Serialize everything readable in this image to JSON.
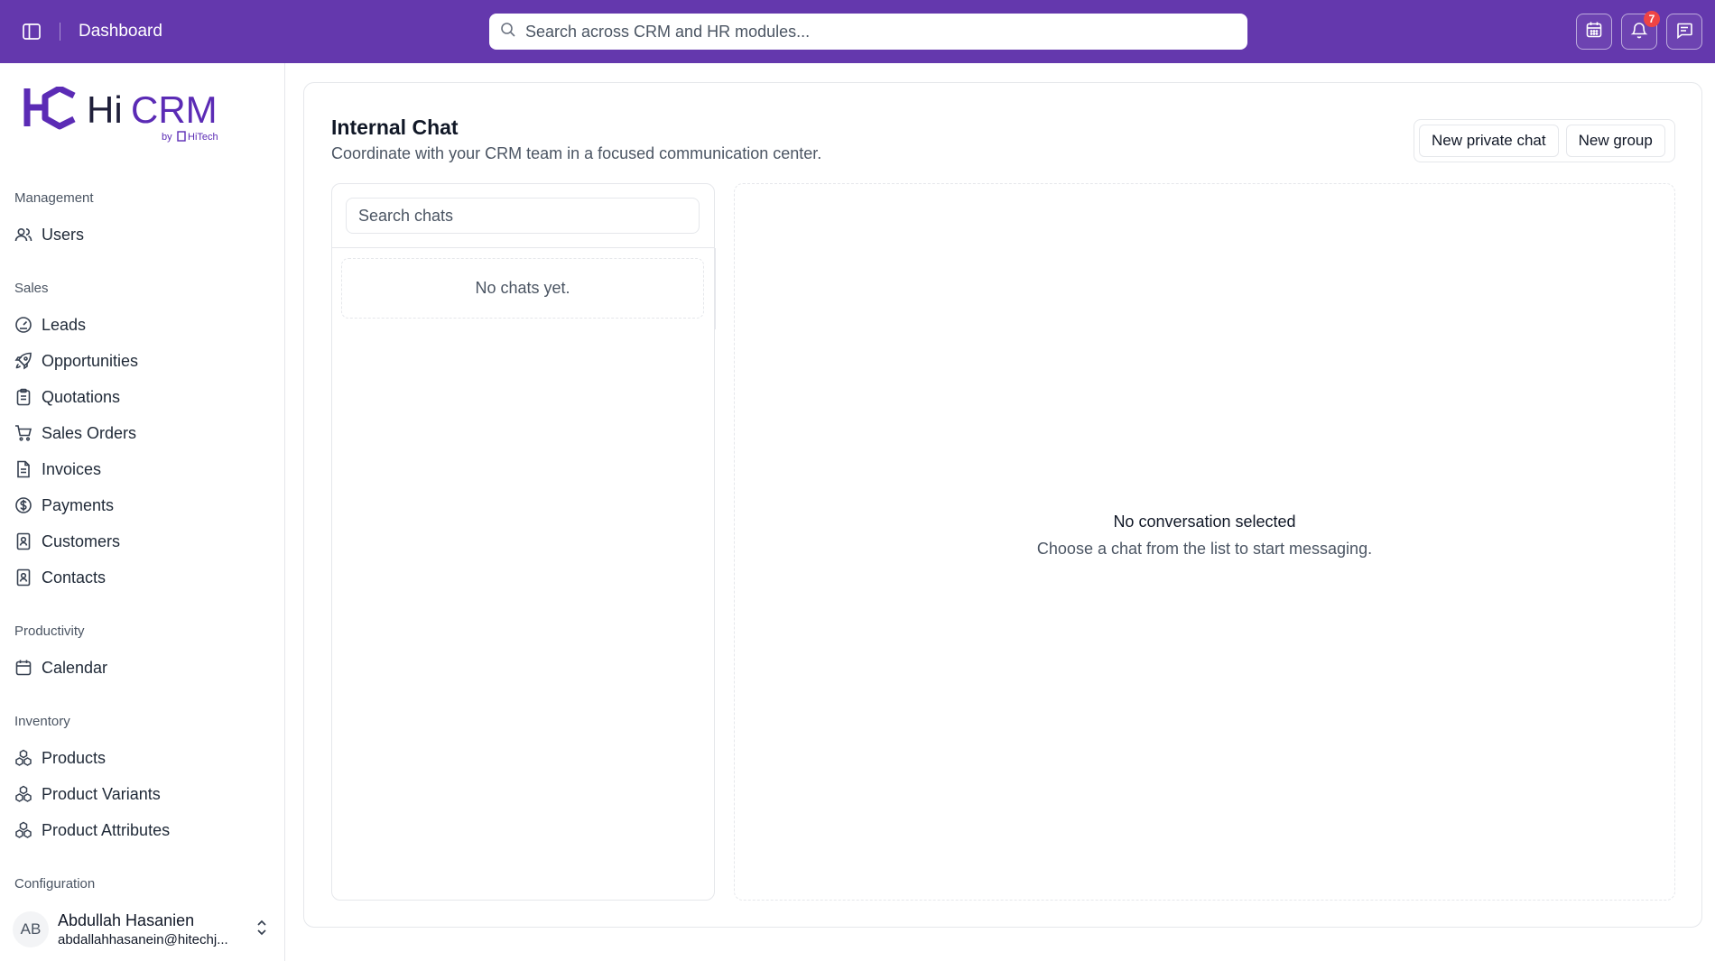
{
  "topbar": {
    "title": "Dashboard",
    "search_placeholder": "Search across CRM and HR modules...",
    "notification_count": "7",
    "bg_color": "#6438ad"
  },
  "brand": {
    "name_hi": "Hi",
    "name_crm": "CRM",
    "by": "by",
    "company": "HiTech",
    "logo_color": "#5b2bb5"
  },
  "sidebar": {
    "groups": [
      {
        "label": "Management",
        "items": [
          {
            "label": "Users",
            "icon": "users-icon"
          }
        ]
      },
      {
        "label": "Sales",
        "items": [
          {
            "label": "Leads",
            "icon": "gauge-icon"
          },
          {
            "label": "Opportunities",
            "icon": "rocket-icon"
          },
          {
            "label": "Quotations",
            "icon": "clipboard-icon"
          },
          {
            "label": "Sales Orders",
            "icon": "cart-icon"
          },
          {
            "label": "Invoices",
            "icon": "file-icon"
          },
          {
            "label": "Payments",
            "icon": "dollar-circle-icon"
          },
          {
            "label": "Customers",
            "icon": "contact-book-icon"
          },
          {
            "label": "Contacts",
            "icon": "contact-book-icon"
          }
        ]
      },
      {
        "label": "Productivity",
        "items": [
          {
            "label": "Calendar",
            "icon": "calendar-icon"
          }
        ]
      },
      {
        "label": "Inventory",
        "items": [
          {
            "label": "Products",
            "icon": "boxes-icon"
          },
          {
            "label": "Product Variants",
            "icon": "boxes-icon"
          },
          {
            "label": "Product Attributes",
            "icon": "boxes-icon"
          }
        ]
      },
      {
        "label": "Configuration",
        "items": []
      }
    ]
  },
  "user": {
    "initials": "AB",
    "name": "Abdullah Hasanien",
    "email": "abdallahhasanein@hitechj..."
  },
  "page": {
    "title": "Internal Chat",
    "subtitle": "Coordinate with your CRM team in a focused communication center.",
    "new_private_chat": "New private chat",
    "new_group": "New group"
  },
  "chat_list": {
    "search_placeholder": "Search chats",
    "empty_text": "No chats yet."
  },
  "conversation": {
    "empty_title": "No conversation selected",
    "empty_subtitle": "Choose a chat from the list to start messaging."
  }
}
